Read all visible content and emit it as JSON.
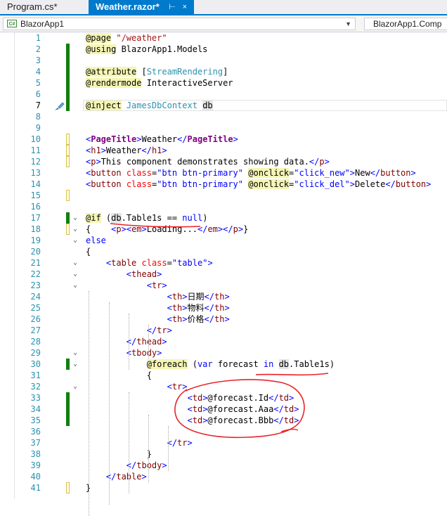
{
  "tabs": [
    {
      "label": "Program.cs*",
      "active": false
    },
    {
      "label": "Weather.razor*",
      "active": true,
      "pin": "⊢",
      "close": "×"
    }
  ],
  "nav": {
    "project_left": "BlazorApp1",
    "project_right": "BlazorApp1.Comp",
    "cs_icon": "C#"
  },
  "colors": {
    "accent": "#007acc",
    "saved_change": "#108010",
    "unsaved_change": "#d7c34a",
    "annotation": "#e8232a"
  },
  "editor": {
    "current_line": 7,
    "lines": [
      {
        "n": "1",
        "tokens": [
          [
            "@page",
            "at"
          ],
          [
            " \"/weather\"",
            "str"
          ]
        ],
        "fold": "",
        "chg": ""
      },
      {
        "n": "2",
        "tokens": [
          [
            "@using",
            "at"
          ],
          [
            " BlazorApp1.Models",
            "plain"
          ]
        ],
        "fold": "",
        "chg": "saved"
      },
      {
        "n": "3",
        "tokens": [],
        "fold": "",
        "chg": "saved"
      },
      {
        "n": "4",
        "tokens": [
          [
            "@attribute",
            "at"
          ],
          [
            " [",
            "plain"
          ],
          [
            "StreamRendering",
            "type"
          ],
          [
            "]",
            "plain"
          ]
        ],
        "fold": "",
        "chg": "saved"
      },
      {
        "n": "5",
        "tokens": [
          [
            "@rendermode",
            "at"
          ],
          [
            " InteractiveServer",
            "plain"
          ]
        ],
        "fold": "",
        "chg": "saved"
      },
      {
        "n": "6",
        "tokens": [],
        "fold": "",
        "chg": "saved"
      },
      {
        "n": "7",
        "tokens": [
          [
            "@inject",
            "at"
          ],
          [
            " ",
            "plain"
          ],
          [
            "JamesDbContext",
            "type"
          ],
          [
            " ",
            "plain"
          ],
          [
            "db",
            "hl"
          ]
        ],
        "fold": "",
        "chg": "saved"
      },
      {
        "n": "8",
        "tokens": [],
        "fold": "",
        "chg": ""
      },
      {
        "n": "9",
        "tokens": [],
        "fold": "",
        "chg": ""
      },
      {
        "n": "10",
        "tokens": [
          [
            "<",
            "kw"
          ],
          [
            "PageTitle",
            "comp"
          ],
          [
            ">",
            "kw"
          ],
          [
            "Weather",
            "plain"
          ],
          [
            "</",
            "kw"
          ],
          [
            "PageTitle",
            "comp"
          ],
          [
            ">",
            "kw"
          ]
        ],
        "fold": "",
        "chg": "unsaved"
      },
      {
        "n": "11",
        "tokens": [
          [
            "<",
            "kw"
          ],
          [
            "h1",
            "brown"
          ],
          [
            ">",
            "kw"
          ],
          [
            "Weather",
            "plain"
          ],
          [
            "</",
            "kw"
          ],
          [
            "h1",
            "brown"
          ],
          [
            ">",
            "kw"
          ]
        ],
        "fold": "",
        "chg": "unsaved"
      },
      {
        "n": "12",
        "tokens": [
          [
            "<",
            "kw"
          ],
          [
            "p",
            "brown"
          ],
          [
            ">",
            "kw"
          ],
          [
            "This component demonstrates showing data.",
            "plain"
          ],
          [
            "</",
            "kw"
          ],
          [
            "p",
            "brown"
          ],
          [
            ">",
            "kw"
          ]
        ],
        "fold": "",
        "chg": "unsaved"
      },
      {
        "n": "13",
        "tokens": [
          [
            "<",
            "kw"
          ],
          [
            "button",
            "brown"
          ],
          [
            " ",
            "plain"
          ],
          [
            "class",
            "attr"
          ],
          [
            "=",
            "plain"
          ],
          [
            "\"btn btn-primary\"",
            "kw"
          ],
          [
            " ",
            "plain"
          ],
          [
            "@onclick",
            "at"
          ],
          [
            "=",
            "plain"
          ],
          [
            "\"click_new\"",
            "kw"
          ],
          [
            ">",
            "kw"
          ],
          [
            "New",
            "plain"
          ],
          [
            "</",
            "kw"
          ],
          [
            "button",
            "brown"
          ],
          [
            ">",
            "kw"
          ]
        ],
        "fold": "",
        "chg": ""
      },
      {
        "n": "14",
        "tokens": [
          [
            "<",
            "kw"
          ],
          [
            "button",
            "brown"
          ],
          [
            " ",
            "plain"
          ],
          [
            "class",
            "attr"
          ],
          [
            "=",
            "plain"
          ],
          [
            "\"btn btn-primary\"",
            "kw"
          ],
          [
            " ",
            "plain"
          ],
          [
            "@onclick",
            "at"
          ],
          [
            "=",
            "plain"
          ],
          [
            "\"click_del\"",
            "kw"
          ],
          [
            ">",
            "kw"
          ],
          [
            "Delete",
            "plain"
          ],
          [
            "</",
            "kw"
          ],
          [
            "button",
            "brown"
          ],
          [
            ">",
            "kw"
          ]
        ],
        "fold": "",
        "chg": ""
      },
      {
        "n": "15",
        "tokens": [],
        "fold": "",
        "chg": "unsaved"
      },
      {
        "n": "16",
        "tokens": [],
        "fold": "",
        "chg": ""
      },
      {
        "n": "17",
        "tokens": [
          [
            "@if",
            "at"
          ],
          [
            " (",
            "plain"
          ],
          [
            "db",
            "hl"
          ],
          [
            ".Table1s == ",
            "plain"
          ],
          [
            "null",
            "kw"
          ],
          [
            ")",
            "plain"
          ]
        ],
        "fold": "⌄",
        "chg": "saved"
      },
      {
        "n": "18",
        "tokens": [
          [
            "{    ",
            "plain"
          ],
          [
            "<",
            "kw"
          ],
          [
            "p",
            "brown"
          ],
          [
            ">",
            "kw"
          ],
          [
            "<",
            "kw"
          ],
          [
            "em",
            "brown"
          ],
          [
            ">",
            "kw"
          ],
          [
            "Loading...",
            "plain"
          ],
          [
            "</",
            "kw"
          ],
          [
            "em",
            "brown"
          ],
          [
            ">",
            "kw"
          ],
          [
            "</",
            "kw"
          ],
          [
            "p",
            "brown"
          ],
          [
            ">",
            "kw"
          ],
          [
            "}",
            "plain"
          ]
        ],
        "fold": "⌄",
        "chg": "unsaved"
      },
      {
        "n": "19",
        "tokens": [
          [
            "else",
            "kw"
          ]
        ],
        "fold": "⌄",
        "chg": ""
      },
      {
        "n": "20",
        "tokens": [
          [
            "{",
            "plain"
          ]
        ],
        "fold": "",
        "chg": ""
      },
      {
        "n": "21",
        "tokens": [
          [
            "    ",
            "plain"
          ],
          [
            "<",
            "kw"
          ],
          [
            "table",
            "brown"
          ],
          [
            " ",
            "plain"
          ],
          [
            "class",
            "attr"
          ],
          [
            "=",
            "plain"
          ],
          [
            "\"table\"",
            "kw"
          ],
          [
            ">",
            "kw"
          ]
        ],
        "fold": "⌄",
        "chg": ""
      },
      {
        "n": "22",
        "tokens": [
          [
            "        ",
            "plain"
          ],
          [
            "<",
            "kw"
          ],
          [
            "thead",
            "brown"
          ],
          [
            ">",
            "kw"
          ]
        ],
        "fold": "⌄",
        "chg": ""
      },
      {
        "n": "23",
        "tokens": [
          [
            "            ",
            "plain"
          ],
          [
            "<",
            "kw"
          ],
          [
            "tr",
            "brown"
          ],
          [
            ">",
            "kw"
          ]
        ],
        "fold": "⌄",
        "chg": ""
      },
      {
        "n": "24",
        "tokens": [
          [
            "                ",
            "plain"
          ],
          [
            "<",
            "kw"
          ],
          [
            "th",
            "brown"
          ],
          [
            ">",
            "kw"
          ],
          [
            "日期",
            "plain"
          ],
          [
            "</",
            "kw"
          ],
          [
            "th",
            "brown"
          ],
          [
            ">",
            "kw"
          ]
        ],
        "fold": "",
        "chg": ""
      },
      {
        "n": "25",
        "tokens": [
          [
            "                ",
            "plain"
          ],
          [
            "<",
            "kw"
          ],
          [
            "th",
            "brown"
          ],
          [
            ">",
            "kw"
          ],
          [
            "物料",
            "plain"
          ],
          [
            "</",
            "kw"
          ],
          [
            "th",
            "brown"
          ],
          [
            ">",
            "kw"
          ]
        ],
        "fold": "",
        "chg": ""
      },
      {
        "n": "26",
        "tokens": [
          [
            "                ",
            "plain"
          ],
          [
            "<",
            "kw"
          ],
          [
            "th",
            "brown"
          ],
          [
            ">",
            "kw"
          ],
          [
            "价格",
            "plain"
          ],
          [
            "</",
            "kw"
          ],
          [
            "th",
            "brown"
          ],
          [
            ">",
            "kw"
          ]
        ],
        "fold": "",
        "chg": ""
      },
      {
        "n": "27",
        "tokens": [
          [
            "            ",
            "plain"
          ],
          [
            "</",
            "kw"
          ],
          [
            "tr",
            "brown"
          ],
          [
            ">",
            "kw"
          ]
        ],
        "fold": "",
        "chg": ""
      },
      {
        "n": "28",
        "tokens": [
          [
            "        ",
            "plain"
          ],
          [
            "</",
            "kw"
          ],
          [
            "thead",
            "brown"
          ],
          [
            ">",
            "kw"
          ]
        ],
        "fold": "",
        "chg": ""
      },
      {
        "n": "29",
        "tokens": [
          [
            "        ",
            "plain"
          ],
          [
            "<",
            "kw"
          ],
          [
            "tbody",
            "brown"
          ],
          [
            ">",
            "kw"
          ]
        ],
        "fold": "⌄",
        "chg": ""
      },
      {
        "n": "30",
        "tokens": [
          [
            "            ",
            "plain"
          ],
          [
            "@foreach",
            "at"
          ],
          [
            " (",
            "plain"
          ],
          [
            "var",
            "kw"
          ],
          [
            " forecast ",
            "plain"
          ],
          [
            "in",
            "kw"
          ],
          [
            " ",
            "plain"
          ],
          [
            "db",
            "hl"
          ],
          [
            ".Table1s)",
            "plain"
          ]
        ],
        "fold": "⌄",
        "chg": "saved"
      },
      {
        "n": "31",
        "tokens": [
          [
            "            {",
            "plain"
          ]
        ],
        "fold": "",
        "chg": ""
      },
      {
        "n": "32",
        "tokens": [
          [
            "                ",
            "plain"
          ],
          [
            "<",
            "kw"
          ],
          [
            "tr",
            "brown"
          ],
          [
            ">",
            "kw"
          ]
        ],
        "fold": "⌄",
        "chg": ""
      },
      {
        "n": "33",
        "tokens": [
          [
            "                    ",
            "plain"
          ],
          [
            "<",
            "kw"
          ],
          [
            "td",
            "brown"
          ],
          [
            ">",
            "kw"
          ],
          [
            "@forecast.Id",
            "plain"
          ],
          [
            "</",
            "kw"
          ],
          [
            "td",
            "brown"
          ],
          [
            ">",
            "kw"
          ]
        ],
        "fold": "",
        "chg": "saved"
      },
      {
        "n": "34",
        "tokens": [
          [
            "                    ",
            "plain"
          ],
          [
            "<",
            "kw"
          ],
          [
            "td",
            "brown"
          ],
          [
            ">",
            "kw"
          ],
          [
            "@forecast.Aaa",
            "plain"
          ],
          [
            "</",
            "kw"
          ],
          [
            "td",
            "brown"
          ],
          [
            ">",
            "kw"
          ]
        ],
        "fold": "",
        "chg": "saved"
      },
      {
        "n": "35",
        "tokens": [
          [
            "                    ",
            "plain"
          ],
          [
            "<",
            "kw"
          ],
          [
            "td",
            "brown"
          ],
          [
            ">",
            "kw"
          ],
          [
            "@forecast.Bbb",
            "plain"
          ],
          [
            "</",
            "kw"
          ],
          [
            "td",
            "brown"
          ],
          [
            ">",
            "kw"
          ]
        ],
        "fold": "",
        "chg": "saved"
      },
      {
        "n": "36",
        "tokens": [],
        "fold": "",
        "chg": ""
      },
      {
        "n": "37",
        "tokens": [
          [
            "                ",
            "plain"
          ],
          [
            "</",
            "kw"
          ],
          [
            "tr",
            "brown"
          ],
          [
            ">",
            "kw"
          ]
        ],
        "fold": "",
        "chg": ""
      },
      {
        "n": "38",
        "tokens": [
          [
            "            }",
            "plain"
          ]
        ],
        "fold": "",
        "chg": ""
      },
      {
        "n": "39",
        "tokens": [
          [
            "        ",
            "plain"
          ],
          [
            "</",
            "kw"
          ],
          [
            "tbody",
            "brown"
          ],
          [
            ">",
            "kw"
          ]
        ],
        "fold": "",
        "chg": ""
      },
      {
        "n": "40",
        "tokens": [
          [
            "    ",
            "plain"
          ],
          [
            "</",
            "kw"
          ],
          [
            "table",
            "brown"
          ],
          [
            ">",
            "kw"
          ]
        ],
        "fold": "",
        "chg": ""
      },
      {
        "n": "41",
        "tokens": [
          [
            "}",
            "plain"
          ]
        ],
        "fold": "",
        "chg": "unsaved"
      }
    ]
  }
}
